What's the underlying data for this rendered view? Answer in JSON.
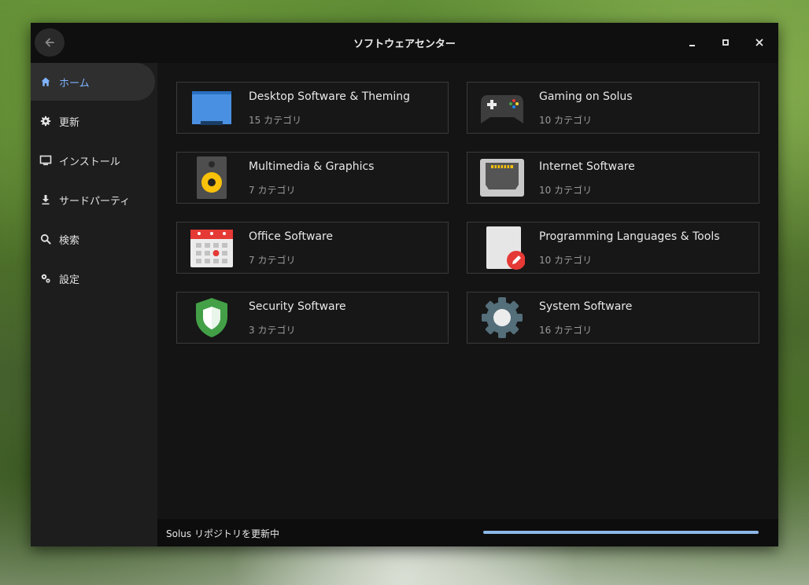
{
  "window": {
    "title": "ソフトウェアセンター"
  },
  "sidebar": {
    "items": [
      {
        "label": "ホーム",
        "icon": "home-icon",
        "active": true
      },
      {
        "label": "更新",
        "icon": "gear-icon"
      },
      {
        "label": "インストール",
        "icon": "monitor-icon"
      },
      {
        "label": "サードパーティ",
        "icon": "download-icon"
      },
      {
        "label": "検索",
        "icon": "search-icon"
      },
      {
        "label": "設定",
        "icon": "settings-icon"
      }
    ]
  },
  "categories": [
    {
      "title": "Desktop Software & Theming",
      "subtitle": "15 カテゴリ",
      "icon": "folder-icon"
    },
    {
      "title": "Gaming on Solus",
      "subtitle": "10 カテゴリ",
      "icon": "gamepad-icon"
    },
    {
      "title": "Multimedia & Graphics",
      "subtitle": "7 カテゴリ",
      "icon": "speaker-icon"
    },
    {
      "title": "Internet Software",
      "subtitle": "10 カテゴリ",
      "icon": "ethernet-icon"
    },
    {
      "title": "Office Software",
      "subtitle": "7 カテゴリ",
      "icon": "calendar-icon"
    },
    {
      "title": "Programming Languages & Tools",
      "subtitle": "10 カテゴリ",
      "icon": "code-edit-icon"
    },
    {
      "title": "Security Software",
      "subtitle": "3 カテゴリ",
      "icon": "shield-icon"
    },
    {
      "title": "System Software",
      "subtitle": "16 カテゴリ",
      "icon": "system-gear-icon"
    }
  ],
  "status": {
    "text": "Solus リポジトリを更新中",
    "progress": 1.0
  },
  "colors": {
    "accent": "#7fb3ff",
    "progress": "#8cb7e6",
    "window_bg": "#121212",
    "sidebar_bg": "#1d1d1d"
  }
}
